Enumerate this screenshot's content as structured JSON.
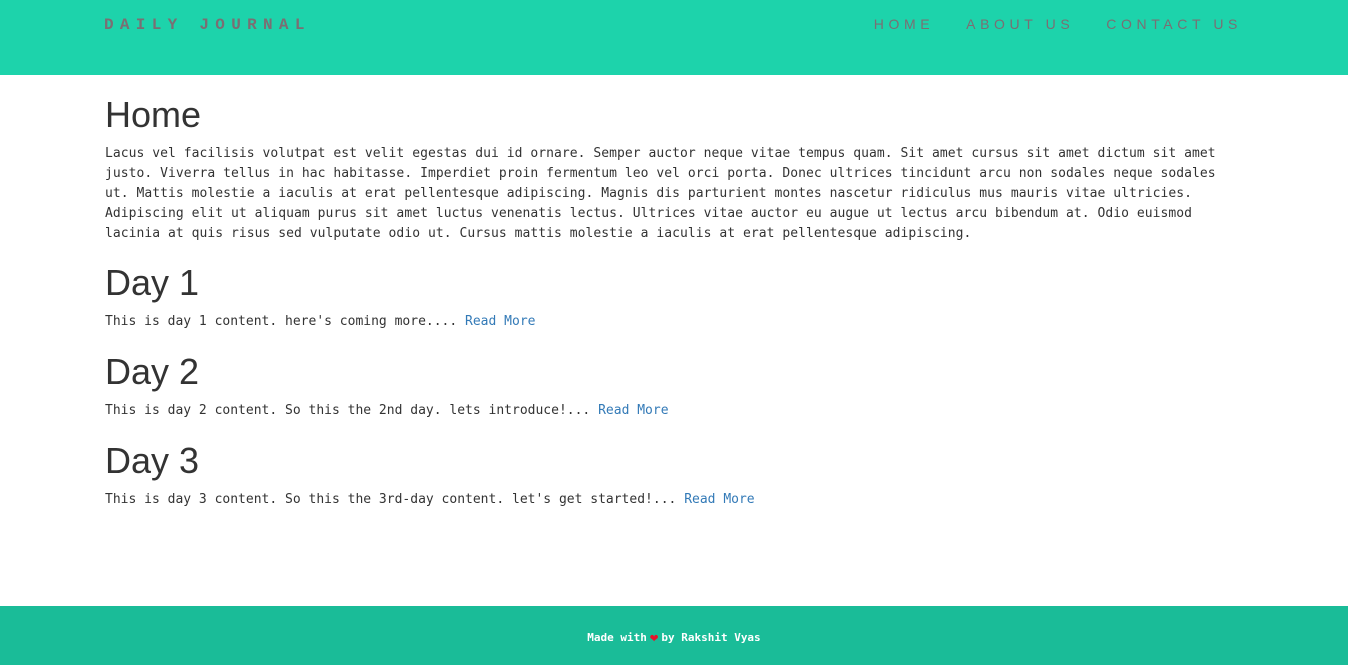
{
  "navbar": {
    "brand": "DAILY JOURNAL",
    "links": [
      "HOME",
      "ABOUT US",
      "CONTACT US"
    ],
    "background": "#1dd3ab",
    "text_color": "#7a6f73"
  },
  "home": {
    "title": "Home",
    "intro": "Lacus vel facilisis volutpat est velit egestas dui id ornare. Semper auctor neque vitae tempus quam. Sit amet cursus sit amet dictum sit amet justo. Viverra tellus in hac habitasse. Imperdiet proin fermentum leo vel orci porta. Donec ultrices tincidunt arcu non sodales neque sodales ut. Mattis molestie a iaculis at erat pellentesque adipiscing. Magnis dis parturient montes nascetur ridiculus mus mauris vitae ultricies. Adipiscing elit ut aliquam purus sit amet luctus venenatis lectus. Ultrices vitae auctor eu augue ut lectus arcu bibendum at. Odio euismod lacinia at quis risus sed vulputate odio ut. Cursus mattis molestie a iaculis at erat pellentesque adipiscing."
  },
  "posts": [
    {
      "title": "Day 1",
      "excerpt": "This is day 1 content. here's coming more....",
      "link": "Read More"
    },
    {
      "title": "Day 2",
      "excerpt": "This is day 2 content. So this the 2nd day. lets introduce!...",
      "link": "Read More"
    },
    {
      "title": "Day 3",
      "excerpt": "This is day 3 content. So this the 3rd-day content. let's get started!...",
      "link": "Read More"
    }
  ],
  "footer": {
    "prefix": "Made with",
    "icon": "heart-icon",
    "suffix": "by Rakshit Vyas",
    "background": "#1abc98",
    "heart_color": "#e8132a"
  }
}
